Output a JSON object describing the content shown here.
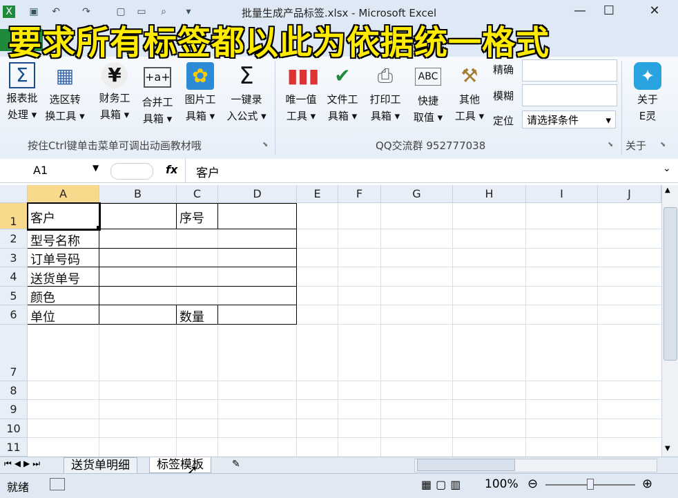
{
  "window": {
    "title": "批量生成产品标签.xlsx - Microsoft Excel"
  },
  "overlay_caption": "要求所有标签都以此为依据统一格式",
  "ribbon": {
    "buttons": [
      {
        "line1": "报表批",
        "line2": "处理",
        "icon": "sigma-table-icon"
      },
      {
        "line1": "选区转",
        "line2": "换工具",
        "icon": "grid-select-icon"
      },
      {
        "line1": "财务工",
        "line2": "具箱",
        "icon": "yen-icon"
      },
      {
        "line1": "合并工",
        "line2": "具箱",
        "icon": "merge-icon"
      },
      {
        "line1": "图片工",
        "line2": "具箱",
        "icon": "sunflower-icon"
      },
      {
        "line1": "一键录",
        "line2": "入公式",
        "icon": "sigma-icon"
      },
      {
        "line1": "唯一值",
        "line2": "工具",
        "icon": "bar-chart-icon"
      },
      {
        "line1": "文件工",
        "line2": "具箱",
        "icon": "excel-file-icon"
      },
      {
        "line1": "打印工",
        "line2": "具箱",
        "icon": "printer-icon"
      },
      {
        "line1": "快捷",
        "line2": "取值",
        "icon": "abc-pen-icon"
      },
      {
        "line1": "其他",
        "line2": "工具",
        "icon": "broom-icon"
      }
    ],
    "side_labels": {
      "precise": "精确",
      "fuzzy": "模糊",
      "locate": "定位"
    },
    "condition_select": "请选择条件",
    "about_button": {
      "line1": "关于",
      "line2": "E灵"
    },
    "group_labels": {
      "left": "按住Ctrl键单击菜单可调出动画教材哦",
      "middle": "QQ交流群  952777038",
      "right": "关于"
    }
  },
  "formula_bar": {
    "name_box": "A1",
    "fx": "fx",
    "content": "客户"
  },
  "columns": [
    "A",
    "B",
    "C",
    "D",
    "E",
    "F",
    "G",
    "H",
    "I",
    "J"
  ],
  "rows": [
    "1",
    "2",
    "3",
    "4",
    "5",
    "6",
    "7",
    "8",
    "9",
    "10",
    "11"
  ],
  "cells": {
    "A1": "客户",
    "C1": "序号",
    "A2": "型号名称",
    "A3": "订单号码",
    "A4": "送货单号",
    "A5": "颜色",
    "A6": "单位",
    "C6": "数量"
  },
  "sheet_tabs": [
    "送货单明细",
    "标签模板"
  ],
  "active_sheet": "标签模板",
  "status": {
    "mode": "就绪",
    "zoom": "100%"
  },
  "colors": {
    "accent_green": "#1f8a3c",
    "overlay_yellow": "#ffeb00"
  }
}
